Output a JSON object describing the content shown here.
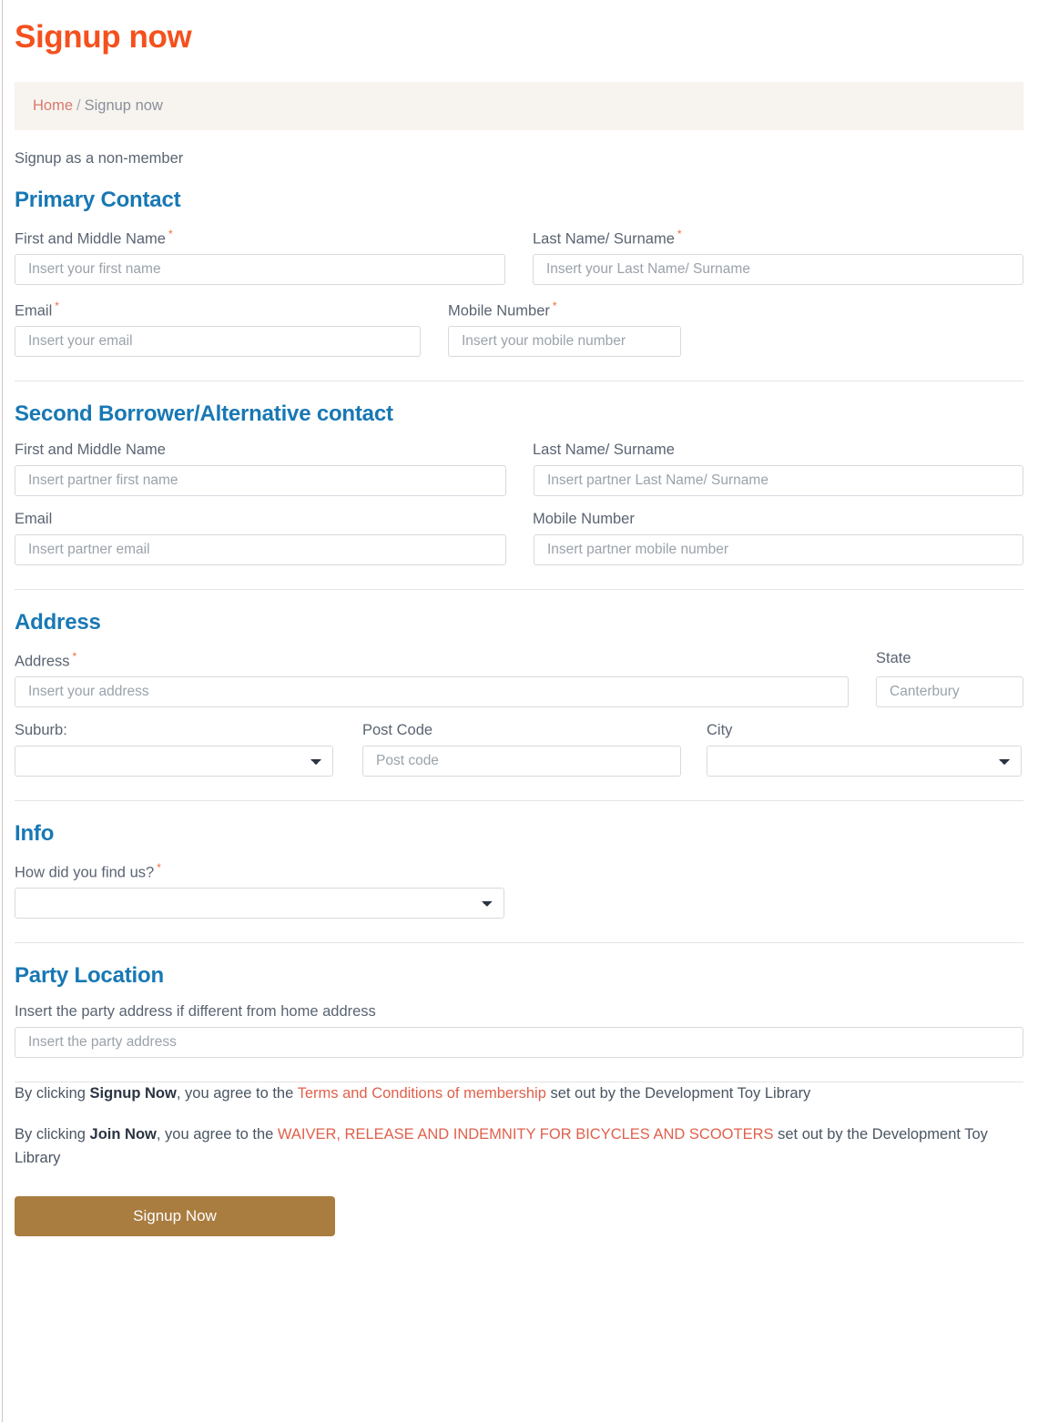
{
  "page": {
    "title": "Signup now",
    "intro": "Signup as a non-member"
  },
  "breadcrumb": {
    "home": "Home",
    "separator": "/",
    "current": "Signup now"
  },
  "sections": {
    "primary": {
      "heading": "Primary Contact",
      "first_name": {
        "label": "First and Middle Name",
        "required": "*",
        "placeholder": "Insert your first name",
        "value": ""
      },
      "last_name": {
        "label": "Last Name/ Surname",
        "required": "*",
        "placeholder": "Insert your Last Name/ Surname",
        "value": ""
      },
      "email": {
        "label": "Email",
        "required": "*",
        "placeholder": "Insert your email",
        "value": ""
      },
      "mobile": {
        "label": "Mobile Number",
        "required": "*",
        "placeholder": "Insert your mobile number",
        "value": ""
      }
    },
    "second": {
      "heading": "Second Borrower/Alternative contact",
      "first_name": {
        "label": "First and Middle Name",
        "placeholder": "Insert partner first name",
        "value": ""
      },
      "last_name": {
        "label": "Last Name/ Surname",
        "placeholder": "Insert partner Last Name/ Surname",
        "value": ""
      },
      "email": {
        "label": "Email",
        "placeholder": "Insert partner email",
        "value": ""
      },
      "mobile": {
        "label": "Mobile Number",
        "placeholder": "Insert partner mobile number",
        "value": ""
      }
    },
    "address": {
      "heading": "Address",
      "address": {
        "label": "Address",
        "required": "*",
        "placeholder": "Insert your address",
        "value": ""
      },
      "state": {
        "label": "State",
        "placeholder": "Canterbury",
        "value": ""
      },
      "suburb": {
        "label": "Suburb:",
        "selected": "",
        "options": [
          ""
        ]
      },
      "post_code": {
        "label": "Post Code",
        "placeholder": "Post code",
        "value": ""
      },
      "city": {
        "label": "City",
        "selected": "",
        "options": [
          ""
        ]
      }
    },
    "info": {
      "heading": "Info",
      "find_us": {
        "label": "How did you find us?",
        "required": "*",
        "selected": "",
        "options": [
          ""
        ]
      }
    },
    "party": {
      "heading": "Party Location",
      "description": "Insert the party address if different from home address",
      "address": {
        "placeholder": "Insert the party address",
        "value": ""
      }
    }
  },
  "terms": {
    "p1_part1": "By clicking ",
    "p1_bold": "Signup Now",
    "p1_part2": ", you agree to the ",
    "p1_link": "Terms and Conditions of membership",
    "p1_part3": " set out by the Development Toy Library",
    "p2_part1": "By clicking ",
    "p2_bold": "Join Now",
    "p2_part2": ", you agree to the ",
    "p2_link": "WAIVER, RELEASE AND INDEMNITY FOR BICYCLES AND SCOOTERS",
    "p2_part3": " set out by the Development Toy Library"
  },
  "submit": {
    "label": "Signup Now"
  },
  "colors": {
    "title_orange": "#f4511e",
    "section_blue": "#1878b4",
    "required_orange": "#ef6c3a",
    "link_red": "#e0604b",
    "breadcrumb_bg": "#f7f4f0",
    "button_brown": "#a97c3f"
  }
}
